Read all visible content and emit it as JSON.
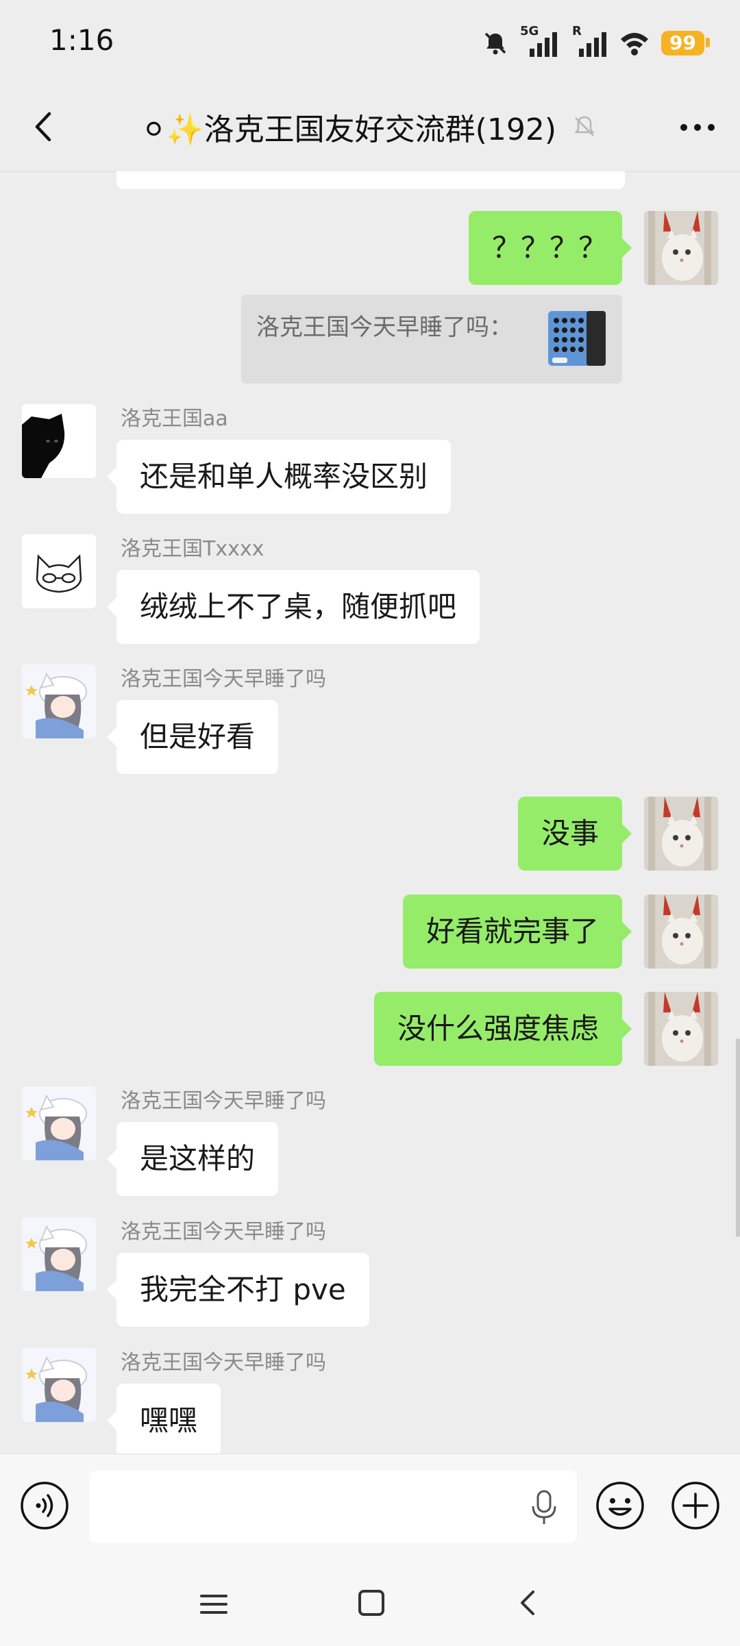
{
  "status_bar": {
    "time": "1:16",
    "battery": "99",
    "network_5g": "5G",
    "network_r": "R"
  },
  "header": {
    "title": "⚪✨洛克王国友好交流群(192)"
  },
  "quote": {
    "text": "洛克王国今天早睡了吗："
  },
  "messages": [
    {
      "direction": "out",
      "text": "？？？？"
    },
    {
      "direction": "in",
      "sender": "洛克王国aa",
      "text": "还是和单人概率没区别"
    },
    {
      "direction": "in",
      "sender": "洛克王国Txxxx",
      "text": "绒绒上不了桌，随便抓吧"
    },
    {
      "direction": "in",
      "sender": "洛克王国今天早睡了吗",
      "text": "但是好看"
    },
    {
      "direction": "out",
      "text": "没事"
    },
    {
      "direction": "out",
      "text": "好看就完事了"
    },
    {
      "direction": "out",
      "text": "没什么强度焦虑"
    },
    {
      "direction": "in",
      "sender": "洛克王国今天早睡了吗",
      "text": "是这样的"
    },
    {
      "direction": "in",
      "sender": "洛克王国今天早睡了吗",
      "text": "我完全不打 pve"
    },
    {
      "direction": "in",
      "sender": "洛克王国今天早睡了吗",
      "text": "嘿嘿"
    }
  ],
  "colors": {
    "background": "#ededed",
    "outgoing_bubble": "#95ec69",
    "incoming_bubble": "#ffffff",
    "battery": "#f5b324"
  },
  "icons": [
    "back-arrow",
    "muted-bell",
    "more-dots",
    "voice",
    "microphone",
    "emoji",
    "plus",
    "nav-menu",
    "nav-home",
    "nav-back"
  ]
}
